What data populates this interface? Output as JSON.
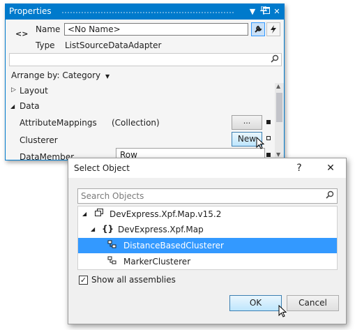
{
  "colors": {
    "accent": "#007acc",
    "selection": "#3399ff",
    "button_hover": "#bee6fd"
  },
  "properties": {
    "title": "Properties",
    "title_icons": [
      "chevron-down-icon",
      "pin-icon",
      "maximize-icon",
      "close-icon"
    ],
    "name_label": "Name",
    "name_value": "<No Name>",
    "type_label": "Type",
    "type_value": "ListSourceDataAdapter",
    "tool_icons": [
      "wrench-icon",
      "lightning-icon"
    ],
    "arrange_by": "Arrange by: Category",
    "categories": {
      "layout": "Layout",
      "data": "Data"
    },
    "rows": {
      "attribute_mappings": {
        "name": "AttributeMappings",
        "value": "(Collection)",
        "button": "..."
      },
      "clusterer": {
        "name": "Clusterer",
        "button": "New"
      },
      "data_member": {
        "name": "DataMember",
        "value": "Row"
      }
    }
  },
  "dialog": {
    "title": "Select Object",
    "help": "?",
    "search_placeholder": "Search Objects",
    "tree": [
      {
        "label": "DevExpress.Xpf.Map.v15.2",
        "icon": "assembly-icon",
        "expanded": true
      },
      {
        "label": "DevExpress.Xpf.Map",
        "icon": "namespace-icon",
        "expanded": true
      },
      {
        "label": "DistanceBasedClusterer",
        "icon": "class-icon",
        "selected": true
      },
      {
        "label": "MarkerClusterer",
        "icon": "class-icon"
      }
    ],
    "show_all_assemblies": "Show all assemblies",
    "show_all_checked": true,
    "ok": "OK",
    "cancel": "Cancel"
  }
}
